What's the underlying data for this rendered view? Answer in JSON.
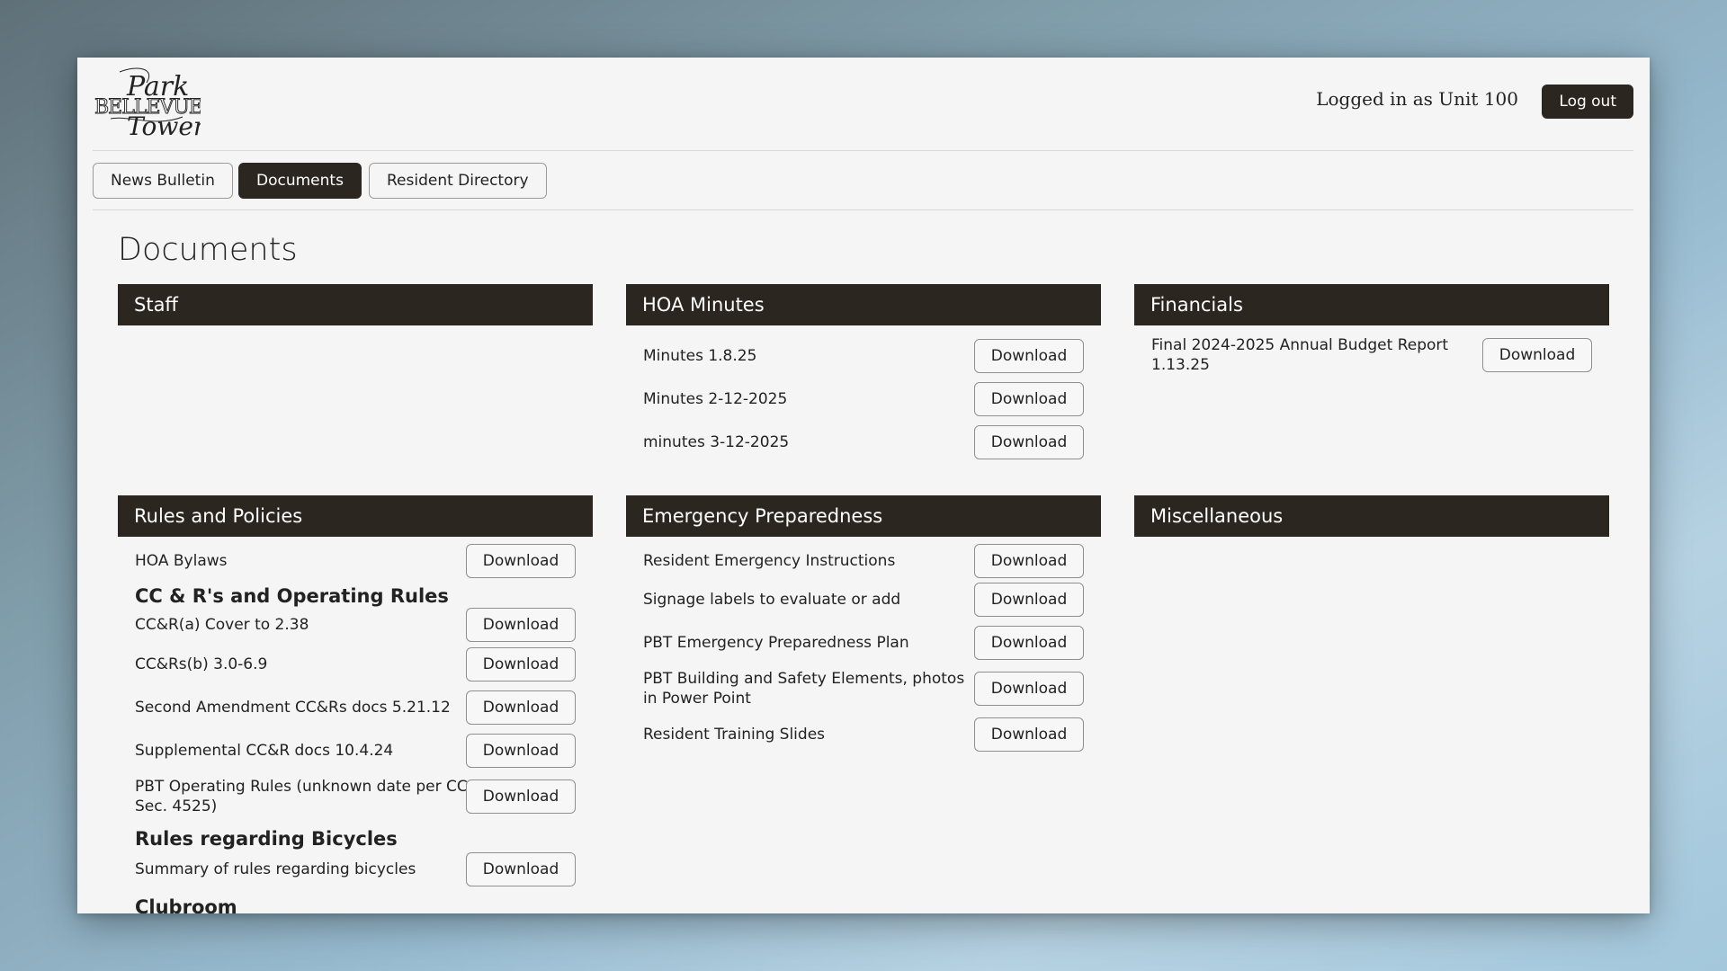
{
  "header": {
    "logo_text": "Park Bellevue Tower",
    "login_status": "Logged in as Unit 100",
    "logout_label": "Log out"
  },
  "nav": {
    "tabs": [
      {
        "label": "News Bulletin"
      },
      {
        "label": "Documents"
      },
      {
        "label": "Resident Directory"
      }
    ],
    "active_tab": "Documents"
  },
  "page_title": "Documents",
  "download_label": "Download",
  "sections": {
    "staff": {
      "title": "Staff"
    },
    "hoa_minutes": {
      "title": "HOA Minutes",
      "items": [
        "Minutes 1.8.25",
        "Minutes 2-12-2025",
        "minutes 3-12-2025"
      ]
    },
    "financials": {
      "title": "Financials",
      "items": [
        "Final 2024-2025 Annual Budget Report 1.13.25"
      ]
    },
    "rules": {
      "title": "Rules and Policies",
      "items": [
        "HOA Bylaws",
        "CC&R(a) Cover to 2.38",
        "CC&Rs(b) 3.0-6.9",
        "Second Amendment CC&Rs docs 5.21.12",
        "Supplemental CC&R docs 10.4.24",
        "PBT Operating Rules (unknown date per CC Sec. 4525)",
        "Summary of rules regarding bicycles"
      ],
      "subheadings": [
        "CC & R's and Operating Rules",
        "Rules regarding Bicycles",
        "Clubroom"
      ]
    },
    "emergency": {
      "title": "Emergency Preparedness",
      "items": [
        "Resident Emergency Instructions",
        "Signage labels to evaluate or add",
        "PBT Emergency Preparedness Plan",
        "PBT Building and Safety Elements, photos in Power Point",
        "Resident Training Slides"
      ]
    },
    "misc": {
      "title": "Miscellaneous"
    }
  }
}
